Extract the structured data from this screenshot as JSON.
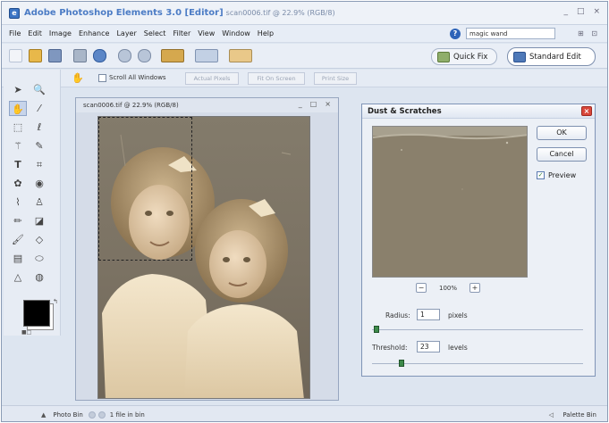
{
  "window": {
    "app_title": "Adobe Photoshop Elements 3.0 [Editor]",
    "doc_title": "scan0006.tif @ 22.9% (RGB/8)",
    "controls": [
      "_",
      "□",
      "×"
    ]
  },
  "menu": {
    "items": [
      "File",
      "Edit",
      "Image",
      "Enhance",
      "Layer",
      "Select",
      "Filter",
      "View",
      "Window",
      "Help"
    ],
    "help_search_value": "magic wand"
  },
  "modes": {
    "quick_fix": "Quick Fix",
    "standard_edit": "Standard Edit"
  },
  "options": {
    "scroll_all_label": "Scroll All Windows",
    "actual_pixels": "Actual Pixels",
    "fit_on_screen": "Fit On Screen",
    "print_size": "Print Size"
  },
  "document": {
    "name": "scan0006.tif @ 22.9% (RGB/8)"
  },
  "dialog": {
    "title": "Dust & Scratches",
    "ok": "OK",
    "cancel": "Cancel",
    "preview_label": "Preview",
    "preview_checked": true,
    "zoom_minus": "−",
    "zoom_plus": "+",
    "zoom": "100%",
    "radius_label": "Radius:",
    "radius_value": "1",
    "radius_unit": "pixels",
    "threshold_label": "Threshold:",
    "threshold_value": "23",
    "threshold_unit": "levels"
  },
  "status": {
    "photo_bin": "Photo Bin",
    "file_count": "1 file in bin",
    "palette_bin": "Palette Bin"
  },
  "colors": {
    "foreground": "#000000",
    "background": "#ffffff",
    "accent": "#4c7cc5"
  }
}
